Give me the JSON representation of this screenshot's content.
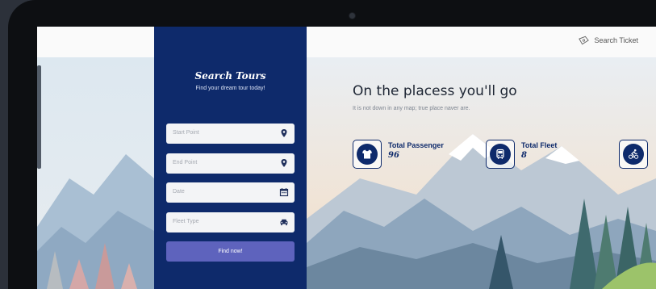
{
  "header": {
    "search_ticket_label": "Search Ticket",
    "search_ticket_icon": "ticket-icon"
  },
  "search_panel": {
    "title": "Search Tours",
    "subtitle": "Find your dream tour today!",
    "fields": [
      {
        "placeholder": "Start Point",
        "icon": "map-pin-icon"
      },
      {
        "placeholder": "End Point",
        "icon": "map-pin-icon"
      },
      {
        "placeholder": "Date",
        "icon": "calendar-icon"
      },
      {
        "placeholder": "Fleet Type",
        "icon": "car-icon"
      }
    ],
    "submit_label": "Find now!"
  },
  "hero": {
    "headline": "On the placess you'll go",
    "subline": "It is not down in any map; true place naver are."
  },
  "stats": [
    {
      "label": "Total Passenger",
      "value": "96",
      "icon": "tshirt-icon"
    },
    {
      "label": "Total Fleet",
      "value": "8",
      "icon": "bus-icon"
    },
    {
      "label": "",
      "value": "",
      "icon": "cyclist-icon"
    }
  ],
  "colors": {
    "panel": "#0e2a6b",
    "button": "#5e63bd",
    "accent": "#0e2a6b"
  }
}
